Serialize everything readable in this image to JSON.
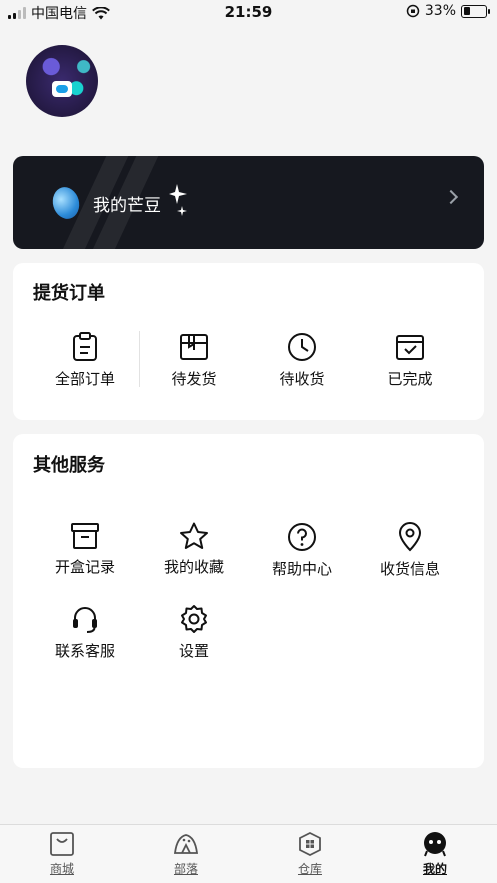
{
  "status_bar": {
    "carrier": "中国电信",
    "time": "21:59",
    "battery": "33%",
    "battery_level": 0.33
  },
  "mango_card": {
    "label": "我的芒豆"
  },
  "orders": {
    "title": "提货订单",
    "items": [
      {
        "label": "全部订单",
        "icon": "clipboard-icon"
      },
      {
        "label": "待发货",
        "icon": "package-icon"
      },
      {
        "label": "待收货",
        "icon": "clock-icon"
      },
      {
        "label": "已完成",
        "icon": "check-box-icon"
      }
    ]
  },
  "services": {
    "title": "其他服务",
    "items": [
      {
        "label": "开盒记录",
        "icon": "archive-box-icon"
      },
      {
        "label": "我的收藏",
        "icon": "star-icon"
      },
      {
        "label": "帮助中心",
        "icon": "help-circle-icon"
      },
      {
        "label": "收货信息",
        "icon": "location-pin-icon"
      },
      {
        "label": "联系客服",
        "icon": "headset-icon"
      },
      {
        "label": "设置",
        "icon": "gear-icon"
      }
    ]
  },
  "tabbar": {
    "active": "我的",
    "items": [
      {
        "label": "商城",
        "icon": "shopping-bag-icon"
      },
      {
        "label": "部落",
        "icon": "tent-icon"
      },
      {
        "label": "仓库",
        "icon": "warehouse-icon"
      },
      {
        "label": "我的",
        "icon": "profile-face-icon"
      }
    ]
  }
}
